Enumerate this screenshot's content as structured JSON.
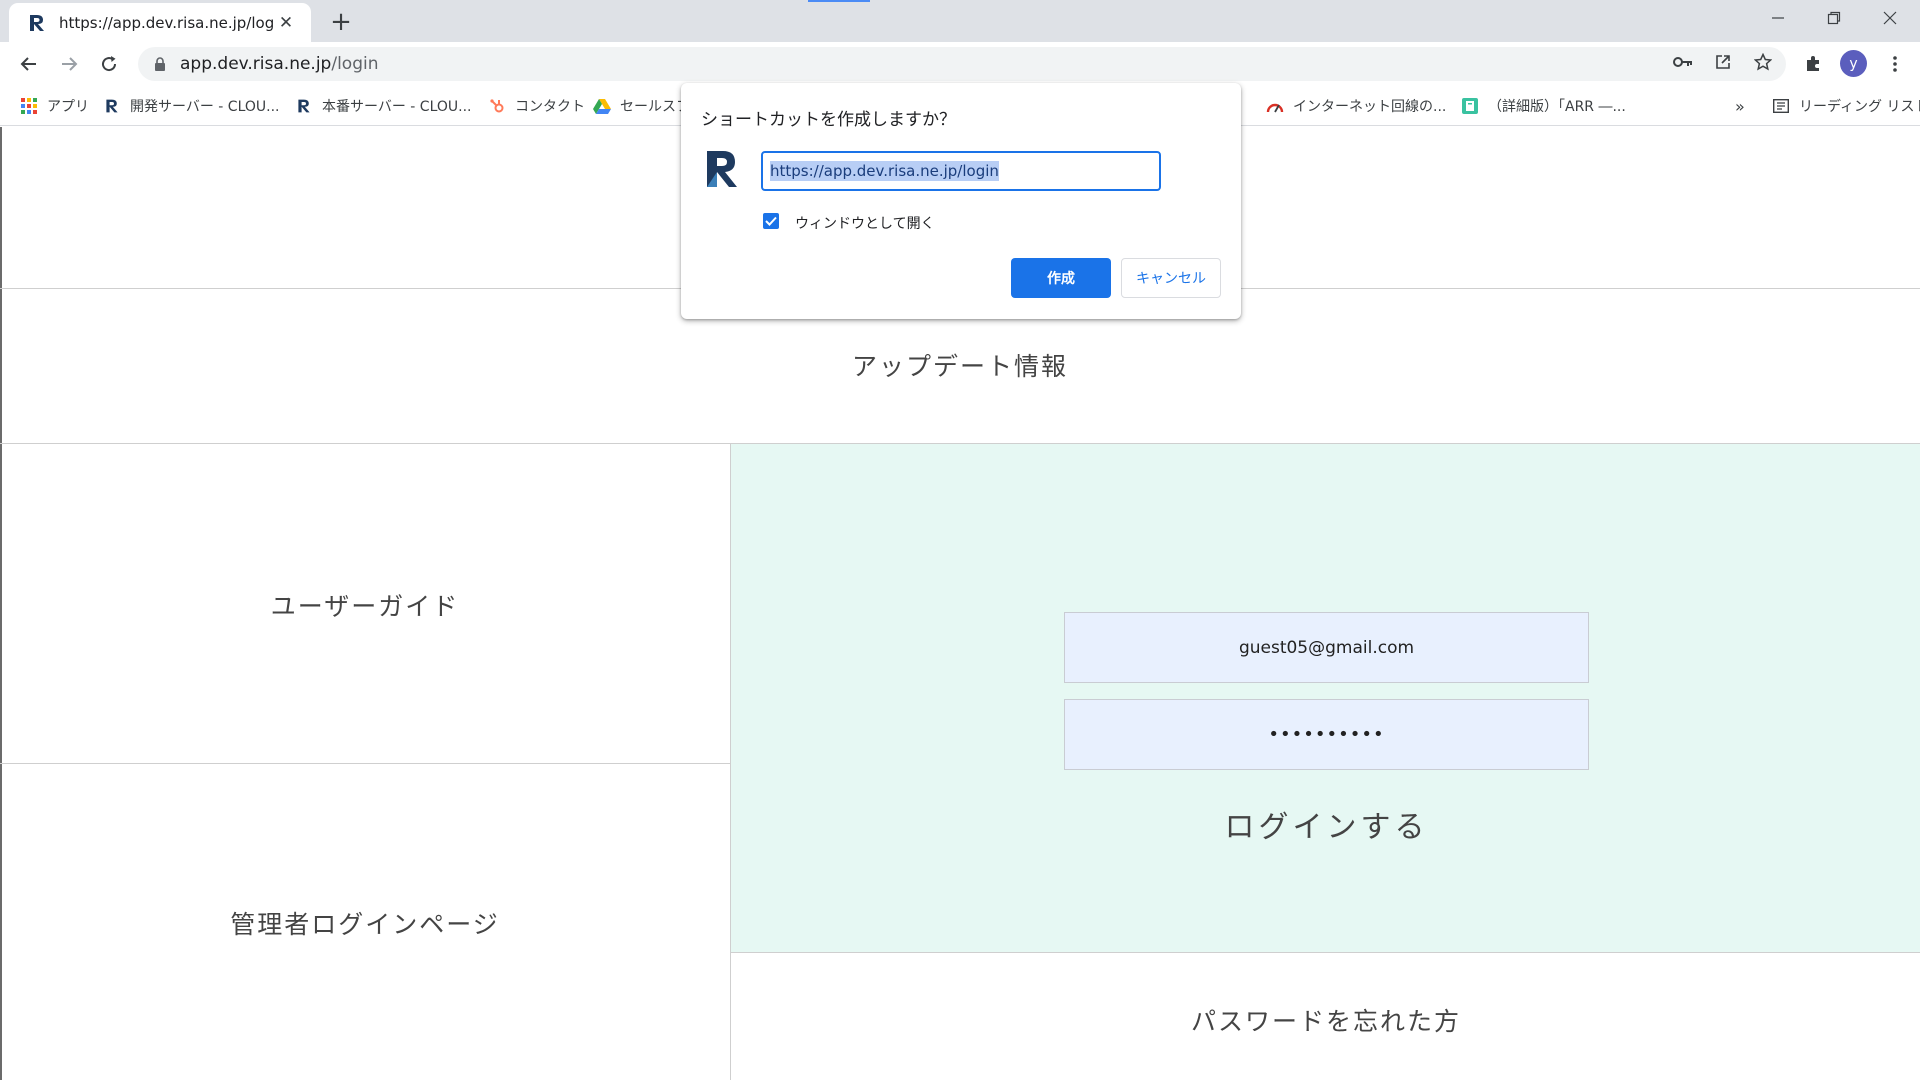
{
  "browser": {
    "tab": {
      "title": "https://app.dev.risa.ne.jp/login"
    },
    "omnibox": {
      "host": "app.dev.risa.ne.jp",
      "path": "/login"
    },
    "profile_initial": "y",
    "bookmarks": [
      {
        "label": "アプリ",
        "icon": "apps-grid-icon"
      },
      {
        "label": "開発サーバー - CLOU...",
        "icon": "risa-logo-icon"
      },
      {
        "label": "本番サーバー - CLOU...",
        "icon": "risa-logo-icon"
      },
      {
        "label": "コンタクト",
        "icon": "hubspot-icon"
      },
      {
        "label": "セールスフ",
        "icon": "google-drive-icon"
      },
      {
        "label": "インターネット回線の...",
        "icon": "speed-gauge-icon"
      },
      {
        "label": "（詳細版）「ARR ―...",
        "icon": "notebook-icon"
      }
    ],
    "more_bookmarks": "»",
    "reading_list": "リーディング リスト"
  },
  "page": {
    "update_info": "アップデート情報",
    "user_guide": "ユーザーガイド",
    "admin_login": "管理者ログインページ",
    "email_value": "guest05@gmail.com",
    "password_value": "••••••••••",
    "login_button": "ログインする",
    "forgot_password": "パスワードを忘れた方"
  },
  "dialog": {
    "title": "ショートカットを作成しますか？",
    "name_value": "https://app.dev.risa.ne.jp/login",
    "open_as_window_label": "ウィンドウとして開く",
    "open_as_window_checked": true,
    "create_button": "作成",
    "cancel_button": "キャンセル"
  },
  "colors": {
    "accent": "#1a73e8",
    "login_panel": "#e6f8f3",
    "field_bg": "#e8f0fe"
  }
}
